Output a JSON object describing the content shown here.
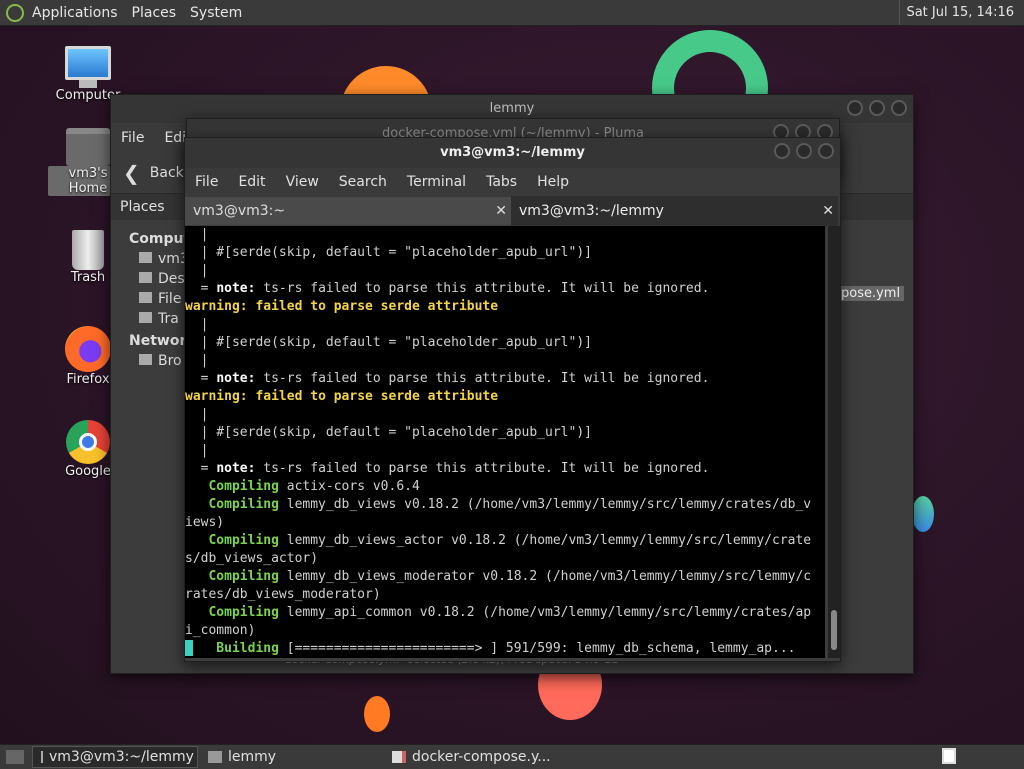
{
  "top_panel": {
    "menus": [
      "Applications",
      "Places",
      "System"
    ],
    "clock": "Sat Jul 15, 14:16"
  },
  "desktop_icons": [
    {
      "label": "Computer",
      "icon": "computer-icon"
    },
    {
      "label": "vm3's Home",
      "icon": "home-folder-icon"
    },
    {
      "label": "Trash",
      "icon": "trash-icon"
    },
    {
      "label": "Firefox",
      "icon": "firefox-icon"
    },
    {
      "label": "Google",
      "icon": "chrome-icon"
    }
  ],
  "file_manager": {
    "title": "lemmy",
    "menu": [
      "File",
      "Edi"
    ],
    "back_label": "Back",
    "places_label": "Places",
    "sidebar": {
      "computer_header": "Compute",
      "items": [
        "vm3",
        "Des",
        "File",
        "Tra"
      ],
      "network_header": "Network",
      "network_items": [
        "Bro"
      ]
    },
    "file_label": "pose.yml",
    "statusbar": "docker-compose.yml\" selected (2.8 kB), Free space: 34.0 GB"
  },
  "pluma": {
    "title": "docker-compose.yml (~/lemmy) - Pluma"
  },
  "terminal": {
    "title": "vm3@vm3:~/lemmy",
    "menu": [
      "File",
      "Edit",
      "View",
      "Search",
      "Terminal",
      "Tabs",
      "Help"
    ],
    "tabs": [
      {
        "label": "vm3@vm3:~",
        "active": false
      },
      {
        "label": "vm3@vm3:~/lemmy",
        "active": true
      }
    ],
    "lines": [
      {
        "type": "plain",
        "text": "  |"
      },
      {
        "type": "plain",
        "text": "  | #[serde(skip, default = \"placeholder_apub_url\")]"
      },
      {
        "type": "plain",
        "text": "  |"
      },
      {
        "type": "note",
        "prefix": "  = ",
        "label": "note:",
        "text": " ts-rs failed to parse this attribute. It will be ignored."
      },
      {
        "type": "warning",
        "label": "warning:",
        "text": " failed to parse serde attribute"
      },
      {
        "type": "plain",
        "text": "  |"
      },
      {
        "type": "plain",
        "text": "  | #[serde(skip, default = \"placeholder_apub_url\")]"
      },
      {
        "type": "plain",
        "text": "  |"
      },
      {
        "type": "note",
        "prefix": "  = ",
        "label": "note:",
        "text": " ts-rs failed to parse this attribute. It will be ignored."
      },
      {
        "type": "warning",
        "label": "warning:",
        "text": " failed to parse serde attribute"
      },
      {
        "type": "plain",
        "text": "  |"
      },
      {
        "type": "plain",
        "text": "  | #[serde(skip, default = \"placeholder_apub_url\")]"
      },
      {
        "type": "plain",
        "text": "  |"
      },
      {
        "type": "note",
        "prefix": "  = ",
        "label": "note:",
        "text": " ts-rs failed to parse this attribute. It will be ignored."
      },
      {
        "type": "compiling",
        "label": "   Compiling",
        "text": " actix-cors v0.6.4"
      },
      {
        "type": "compiling",
        "label": "   Compiling",
        "text": " lemmy_db_views v0.18.2 (/home/vm3/lemmy/lemmy/src/lemmy/crates/db_v"
      },
      {
        "type": "plain",
        "text": "iews)"
      },
      {
        "type": "compiling",
        "label": "   Compiling",
        "text": " lemmy_db_views_actor v0.18.2 (/home/vm3/lemmy/lemmy/src/lemmy/crate"
      },
      {
        "type": "plain",
        "text": "s/db_views_actor)"
      },
      {
        "type": "compiling",
        "label": "   Compiling",
        "text": " lemmy_db_views_moderator v0.18.2 (/home/vm3/lemmy/lemmy/src/lemmy/c"
      },
      {
        "type": "plain",
        "text": "rates/db_views_moderator)"
      },
      {
        "type": "compiling",
        "label": "   Compiling",
        "text": " lemmy_api_common v0.18.2 (/home/vm3/lemmy/lemmy/src/lemmy/crates/ap"
      },
      {
        "type": "plain",
        "text": "i_common)"
      },
      {
        "type": "building",
        "label": "    Building",
        "text": " [=======================> ] 591/599: lemmy_db_schema, lemmy_ap..."
      }
    ]
  },
  "taskbar": {
    "tasks": [
      {
        "label": "vm3@vm3:~/lemmy",
        "icon": "terminal-icon",
        "active": true
      },
      {
        "label": "lemmy",
        "icon": "folder-icon",
        "active": false
      },
      {
        "label": "docker-compose.y...",
        "icon": "text-editor-icon",
        "active": false
      }
    ]
  }
}
